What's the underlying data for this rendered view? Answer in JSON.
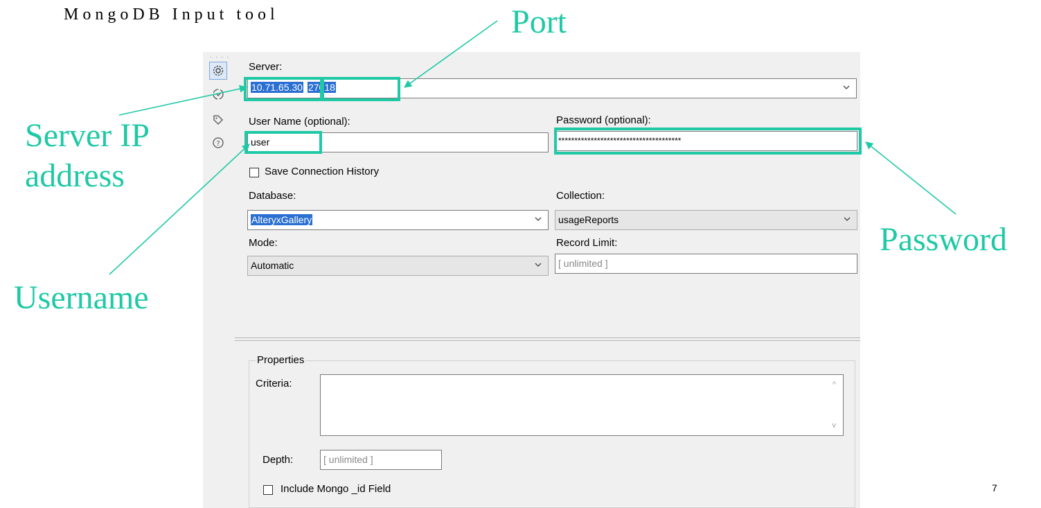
{
  "slide": {
    "title": "MongoDB Input tool",
    "page_number": "7"
  },
  "callouts": {
    "port": "Port",
    "server_ip_line1": "Server IP",
    "server_ip_line2": "address",
    "username": "Username",
    "password": "Password"
  },
  "sidebar": {
    "icons": [
      "gear-icon",
      "connection-icon",
      "tag-icon",
      "help-icon"
    ]
  },
  "form": {
    "server_label": "Server:",
    "server_ip": "10.71.65.30",
    "server_port": "27018",
    "username_label": "User Name (optional):",
    "username_value": "user",
    "password_label": "Password (optional):",
    "password_value": "**************************************",
    "save_history_label": "Save Connection History",
    "save_history_checked": false,
    "database_label": "Database:",
    "database_value": "AlteryxGallery",
    "collection_label": "Collection:",
    "collection_value": "usageReports",
    "mode_label": "Mode:",
    "mode_value": "Automatic",
    "record_limit_label": "Record Limit:",
    "record_limit_placeholder": "[ unlimited ]"
  },
  "properties": {
    "title": "Properties",
    "criteria_label": "Criteria:",
    "depth_label": "Depth:",
    "depth_placeholder": "[ unlimited ]",
    "include_id_label": "Include Mongo _id Field",
    "include_id_checked": false
  },
  "colors": {
    "accent": "#1fc9a6",
    "selection": "#2a6fd1",
    "panel_bg": "#f0f0f0"
  }
}
